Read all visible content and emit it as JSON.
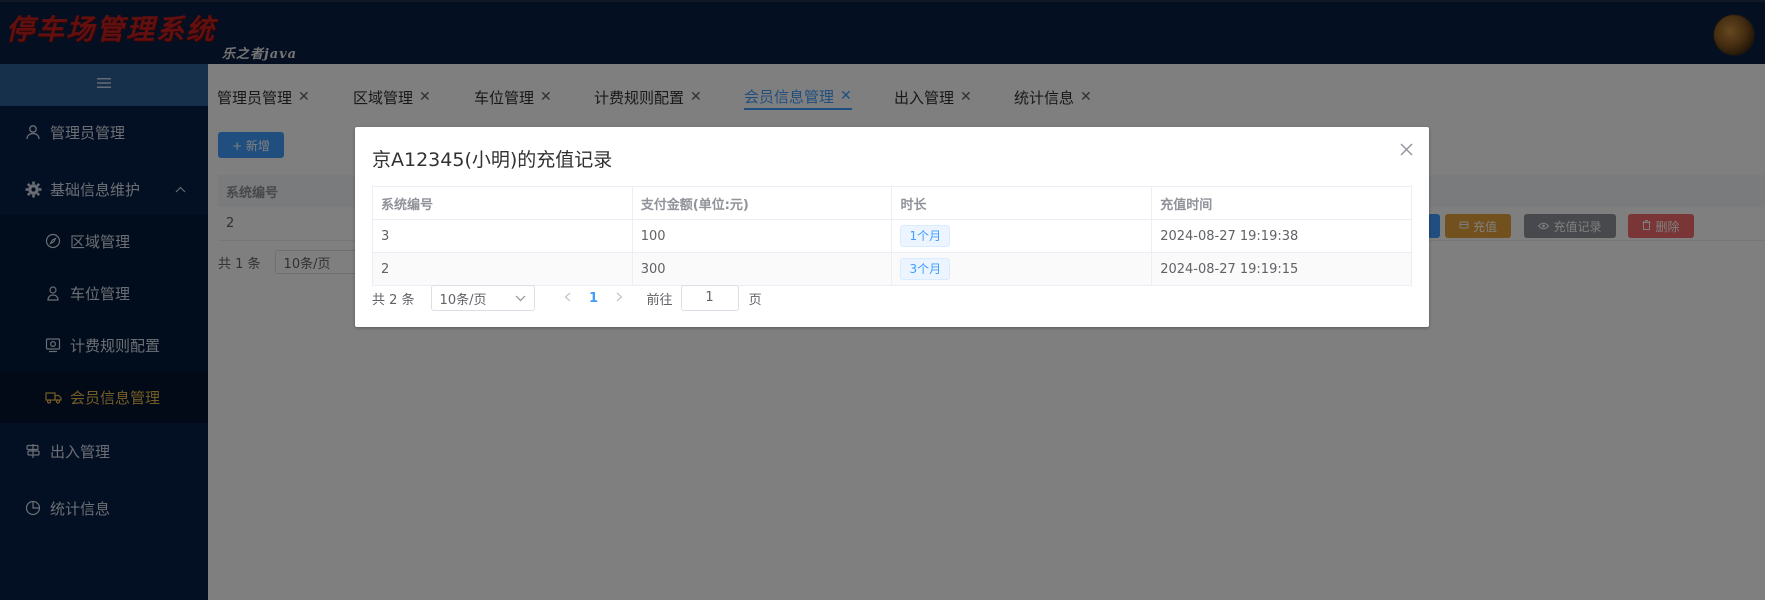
{
  "header": {
    "title": "停车场管理系统",
    "subtitle": "乐之者java"
  },
  "sidebar": {
    "collapse_icon": "menu-icon",
    "items": [
      {
        "label": "管理员管理",
        "icon": "user-icon"
      },
      {
        "label": "基础信息维护",
        "icon": "gear-icon"
      },
      {
        "label": "区域管理",
        "icon": "compass-icon"
      },
      {
        "label": "车位管理",
        "icon": "person-icon"
      },
      {
        "label": "计费规则配置",
        "icon": "camera-icon"
      },
      {
        "label": "会员信息管理",
        "icon": "truck-icon"
      },
      {
        "label": "出入管理",
        "icon": "signpost-icon"
      },
      {
        "label": "统计信息",
        "icon": "pie-chart-icon"
      }
    ]
  },
  "tabs": [
    {
      "label": "管理员管理"
    },
    {
      "label": "区域管理"
    },
    {
      "label": "车位管理"
    },
    {
      "label": "计费规则配置"
    },
    {
      "label": "会员信息管理",
      "active": true
    },
    {
      "label": "出入管理"
    },
    {
      "label": "统计信息"
    }
  ],
  "background": {
    "add_button": "+ 新增",
    "table_header_first": "系统编号",
    "table_row_first": "2",
    "actions": {
      "recharge": "充值",
      "records": "充值记录",
      "delete": "删除"
    },
    "footer_total": "共 1 条",
    "footer_page_size": "10条/页"
  },
  "dialog": {
    "title": "京A12345(小明)的充值记录",
    "columns": [
      "系统编号",
      "支付金额(单位:元)",
      "时长",
      "充值时间"
    ],
    "rows": [
      {
        "id": "3",
        "amount": "100",
        "duration": "1个月",
        "time": "2024-08-27 19:19:38"
      },
      {
        "id": "2",
        "amount": "300",
        "duration": "3个月",
        "time": "2024-08-27 19:19:15"
      }
    ],
    "pagination": {
      "total": "共 2 条",
      "page_size": "10条/页",
      "current_page": "1",
      "goto_label": "前往",
      "goto_value": "1",
      "page_suffix": "页"
    }
  },
  "colors": {
    "header_bg": "#0a1f44",
    "sidebar_bg": "#072146",
    "accent": "#409eff",
    "active_menu": "#e8b84a",
    "recharge_btn": "#e6a23c",
    "records_btn": "#909399",
    "delete_btn": "#f56c6c"
  }
}
